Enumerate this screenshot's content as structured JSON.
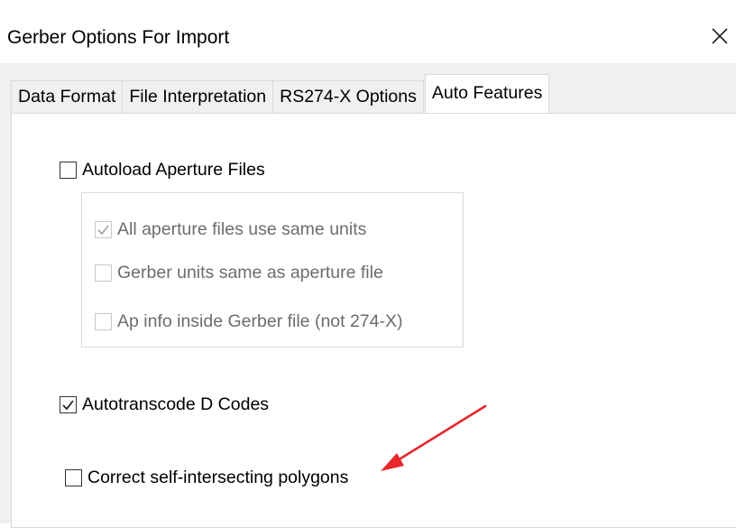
{
  "window": {
    "title": "Gerber Options For Import"
  },
  "tabs": [
    {
      "label": "Data Format",
      "active": false
    },
    {
      "label": "File Interpretation",
      "active": false
    },
    {
      "label": "RS274-X Options",
      "active": false
    },
    {
      "label": "Auto Features",
      "active": true
    }
  ],
  "options": {
    "autoload": {
      "label": "Autoload Aperture Files",
      "checked": false,
      "enabled": true
    },
    "same_units": {
      "label": "All aperture files use same units",
      "checked": true,
      "enabled": false
    },
    "gerber_units": {
      "label": "Gerber units same as aperture file",
      "checked": false,
      "enabled": false
    },
    "ap_info": {
      "label": "Ap info inside Gerber file (not 274-X)",
      "checked": false,
      "enabled": false
    },
    "autotranscode": {
      "label": "Autotranscode D Codes",
      "checked": true,
      "enabled": true
    },
    "correct_polygons": {
      "label": "Correct self-intersecting polygons",
      "checked": false,
      "enabled": true
    }
  },
  "colors": {
    "annotation_arrow": "#e8262b",
    "dialog_background": "#f0f0f0",
    "panel_background": "#ffffff"
  },
  "icons": {
    "close": "close-icon",
    "check": "checkmark-icon",
    "annotation": "red-arrow-icon"
  }
}
